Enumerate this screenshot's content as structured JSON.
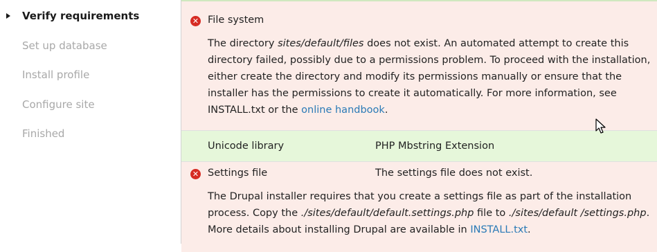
{
  "sidebar": {
    "tasks": [
      {
        "label": "Verify requirements",
        "active": true
      },
      {
        "label": "Set up database"
      },
      {
        "label": "Install profile"
      },
      {
        "label": "Configure site"
      },
      {
        "label": "Finished"
      }
    ]
  },
  "requirements": {
    "file_system": {
      "title": "File system",
      "status_icon": "error-icon",
      "desc_1": "The directory ",
      "desc_path": "sites/default/files",
      "desc_2": " does not exist. An automated attempt to create this directory failed, possibly due to a permissions problem. To proceed with the installation, either create the directory and modify its permissions manually or ensure that the installer has the permissions to create it automatically. For more information, see INSTALL.txt or the ",
      "desc_link": "online handbook",
      "desc_3": "."
    },
    "unicode": {
      "title": "Unicode library",
      "value": "PHP Mbstring Extension"
    },
    "settings_file": {
      "title": "Settings file",
      "status_icon": "error-icon",
      "value": "The settings file does not exist.",
      "desc_1": "The Drupal installer requires that you create a settings file as part of the installation process. Copy the ",
      "desc_path_1": "./sites/default/default.settings.php",
      "desc_2": " file to ",
      "desc_path_2": "./sites/default /settings.php",
      "desc_3": ". More details about installing Drupal are available in ",
      "desc_link": "INSTALL.txt",
      "desc_4": "."
    }
  },
  "colors": {
    "error_bg": "#fcece8",
    "ok_bg": "#e6f7da",
    "link": "#2a7ab6",
    "error_icon": "#d62b23"
  }
}
